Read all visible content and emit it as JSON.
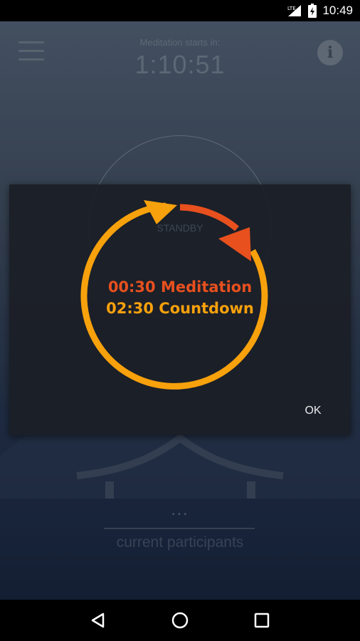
{
  "status_bar": {
    "time": "10:49",
    "icons": [
      "lte-signal-icon",
      "battery-icon"
    ]
  },
  "header": {
    "menu_icon": "hamburger-menu-icon",
    "timer_label": "Meditation starts in:",
    "timer_value": "1:10:51",
    "info_icon": "info-icon",
    "info_glyph": "i"
  },
  "background": {
    "status": "STANDBY",
    "participants_count": "...",
    "participants_label": "current participants"
  },
  "dialog": {
    "meditation_line": "00:30 Meditation",
    "countdown_line": "02:30 Countdown",
    "ok_label": "OK",
    "colors": {
      "meditation": "#e8501e",
      "countdown": "#f7a10c"
    }
  },
  "nav_bar": {
    "back_icon": "back-triangle-icon",
    "home_icon": "home-circle-icon",
    "recents_icon": "recents-square-icon"
  }
}
